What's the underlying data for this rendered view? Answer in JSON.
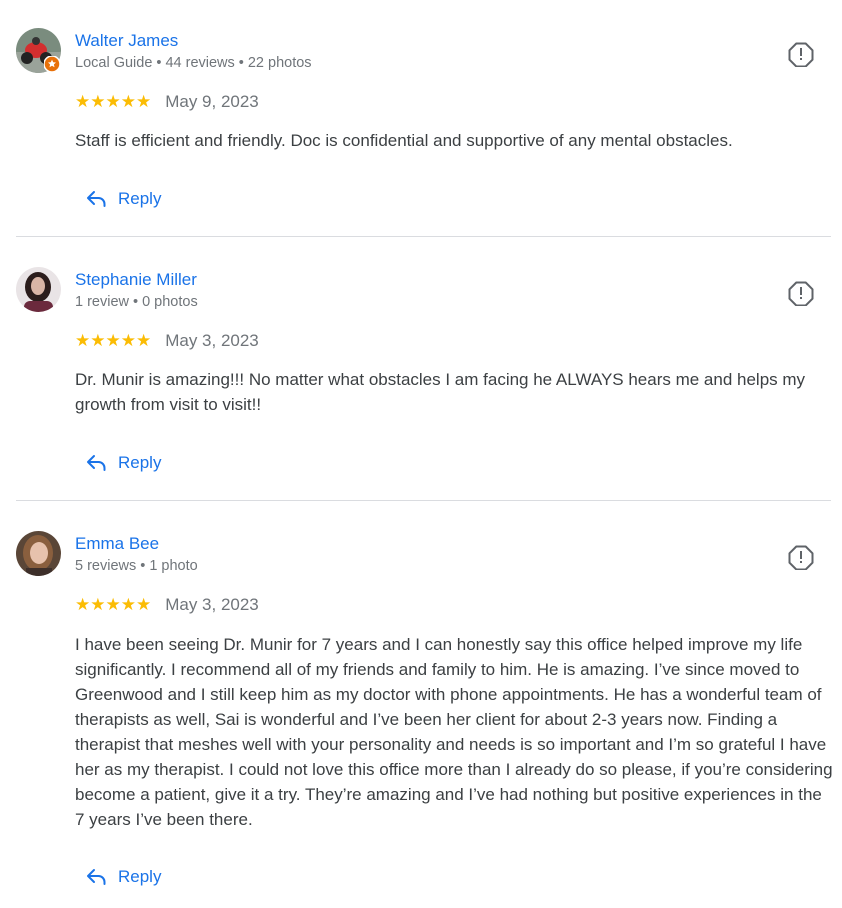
{
  "reviews": [
    {
      "name": "Walter James",
      "meta": [
        "Local Guide",
        "44 reviews",
        "22 photos"
      ],
      "stars": "★★★★★",
      "date": "May 9, 2023",
      "text": "Staff is efficient and friendly. Doc is confidential and supportive of any mental obstacles.",
      "reply_label": "Reply",
      "local_guide": true
    },
    {
      "name": "Stephanie Miller",
      "meta": [
        "1 review",
        "0 photos"
      ],
      "stars": "★★★★★",
      "date": "May 3, 2023",
      "text": "Dr. Munir is amazing!!! No matter what obstacles I am facing he ALWAYS hears me and helps my growth from visit to visit!!",
      "reply_label": "Reply",
      "local_guide": false
    },
    {
      "name": "Emma Bee",
      "meta": [
        "5 reviews",
        "1 photo"
      ],
      "stars": "★★★★★",
      "date": "May 3, 2023",
      "text": "I have been seeing Dr. Munir for 7 years and I can honestly say this office helped improve my life significantly. I recommend all of my friends and family to him. He is amazing. I’ve since moved to Greenwood and I still keep him as my doctor with phone appointments. He has a wonderful team of therapists as well, Sai is wonderful and I’ve been her client for about 2-3 years now. Finding a therapist that meshes well with your personality and needs is so important and I’m so grateful I have her as my therapist. I could not love this office more than I already do so please, if you’re considering become a patient, give it a try. They’re amazing and I’ve had nothing but positive experiences in the 7 years I’ve been there.",
      "reply_label": "Reply",
      "local_guide": false
    }
  ],
  "colors": {
    "link": "#1a73e8",
    "star": "#fbbc04",
    "meta": "#70757a",
    "text": "#3c4043",
    "divider": "#dadce0",
    "guide_badge": "#e8710a"
  },
  "icons": {
    "flag": "report-flag-icon",
    "reply": "reply-arrow-icon",
    "guide": "local-guide-badge-icon"
  }
}
